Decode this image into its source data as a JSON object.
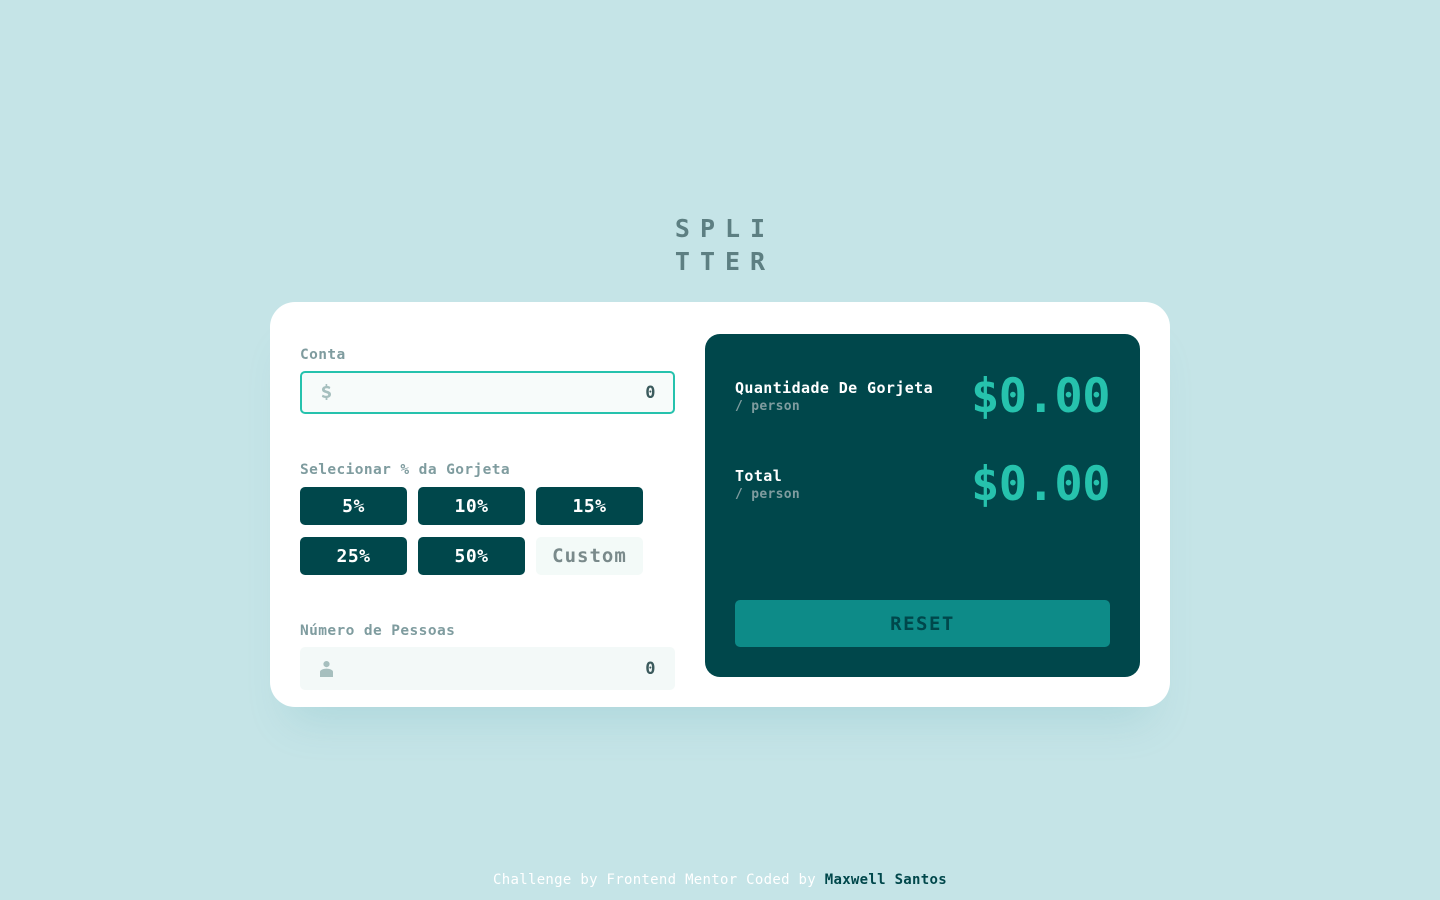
{
  "logo": {
    "line1": "SPLI",
    "line2": "TTER"
  },
  "colors": {
    "background": "#c5e4e7",
    "card": "#ffffff",
    "panel_dark": "#00474b",
    "accent_teal": "#26c2ad",
    "reset_button": "#0d8b88",
    "label_muted": "#7f9c9f",
    "input_bg": "#f3f9f8"
  },
  "form": {
    "bill": {
      "label": "Conta",
      "icon": "dollar-icon",
      "value": "0",
      "placeholder": "0",
      "focused": true
    },
    "tip": {
      "label": "Selecionar % da Gorjeta",
      "options": [
        {
          "label": "5%",
          "value": 5,
          "selected": false
        },
        {
          "label": "10%",
          "value": 10,
          "selected": false
        },
        {
          "label": "15%",
          "value": 15,
          "selected": false
        },
        {
          "label": "25%",
          "value": 25,
          "selected": false
        },
        {
          "label": "50%",
          "value": 50,
          "selected": false
        }
      ],
      "custom_placeholder": "Custom",
      "custom_value": ""
    },
    "people": {
      "label": "Número de Pessoas",
      "icon": "person-icon",
      "value": "0",
      "placeholder": "0",
      "focused": false
    }
  },
  "results": {
    "tip_amount": {
      "label": "Quantidade De Gorjeta",
      "sublabel": "/ person",
      "amount": "$0.00"
    },
    "total": {
      "label": "Total",
      "sublabel": "/ person",
      "amount": "$0.00"
    },
    "reset_label": "RESET"
  },
  "footer": {
    "text": "Challenge by Frontend Mentor Coded by ",
    "author": "Maxwell Santos"
  }
}
